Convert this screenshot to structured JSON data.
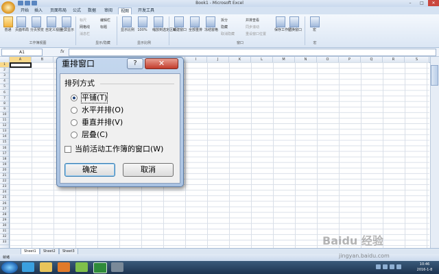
{
  "window": {
    "title": "Book1 - Microsoft Excel",
    "min": "–",
    "max": "□",
    "close": "✕"
  },
  "ribbon_tabs": [
    "开始",
    "插入",
    "页面布局",
    "公式",
    "数据",
    "审阅",
    "视图",
    "开发工具"
  ],
  "active_tab": "视图",
  "ribbon": {
    "workbook_views": {
      "label": "工作簿视图",
      "buttons": [
        "普通",
        "页面布局",
        "分页预览",
        "自定义视图",
        "全屏显示"
      ]
    },
    "show_hide": {
      "label": "显示/隐藏",
      "items": [
        "标尺",
        "网格线",
        "消息栏",
        "编辑栏",
        "标题"
      ]
    },
    "zoom": {
      "label": "显示比例",
      "buttons": [
        "显示比例",
        "100%",
        "缩放到选定区域"
      ]
    },
    "window": {
      "label": "窗口",
      "buttons": [
        "新建窗口",
        "全部重排",
        "冻结窗格"
      ],
      "small": [
        "拆分",
        "隐藏",
        "取消隐藏",
        "并排查看",
        "同步滚动",
        "重设窗口位置"
      ],
      "big": [
        "保存工作区",
        "切换窗口"
      ]
    },
    "macro": {
      "label": "宏",
      "buttons": [
        "宏"
      ]
    }
  },
  "formula_bar": {
    "name_box": "A1",
    "fx": "fx",
    "value": ""
  },
  "columns": [
    "A",
    "B",
    "C",
    "D",
    "E",
    "F",
    "G",
    "H",
    "I",
    "J",
    "K",
    "L",
    "M",
    "N",
    "O",
    "P",
    "Q",
    "R",
    "S"
  ],
  "rows": [
    "1",
    "2",
    "3",
    "4",
    "5",
    "6",
    "7",
    "8",
    "9",
    "10",
    "11",
    "12",
    "13",
    "14",
    "15",
    "16",
    "17",
    "18",
    "19",
    "20",
    "21",
    "22",
    "23",
    "24",
    "25",
    "26",
    "27",
    "28",
    "29",
    "30",
    "31",
    "32",
    "33"
  ],
  "sheet_tabs": [
    "Sheet1",
    "Sheet2",
    "Sheet3"
  ],
  "status": {
    "ready": "就绪"
  },
  "dialog": {
    "title": "重排窗口",
    "help": "?",
    "close": "✕",
    "group_title": "排列方式",
    "options": [
      {
        "label": "平铺(T)",
        "selected": true
      },
      {
        "label": "水平并排(O)",
        "selected": false
      },
      {
        "label": "垂直并排(V)",
        "selected": false
      },
      {
        "label": "层叠(C)",
        "selected": false
      }
    ],
    "checkbox_label": "当前活动工作簿的窗口(W)",
    "checkbox_checked": false,
    "ok": "确定",
    "cancel": "取消"
  },
  "taskbar": {
    "time": "10:46",
    "date": "2016-1-8"
  },
  "watermark": {
    "text": "Baidu 经验",
    "url": "jingyan.baidu.com"
  }
}
